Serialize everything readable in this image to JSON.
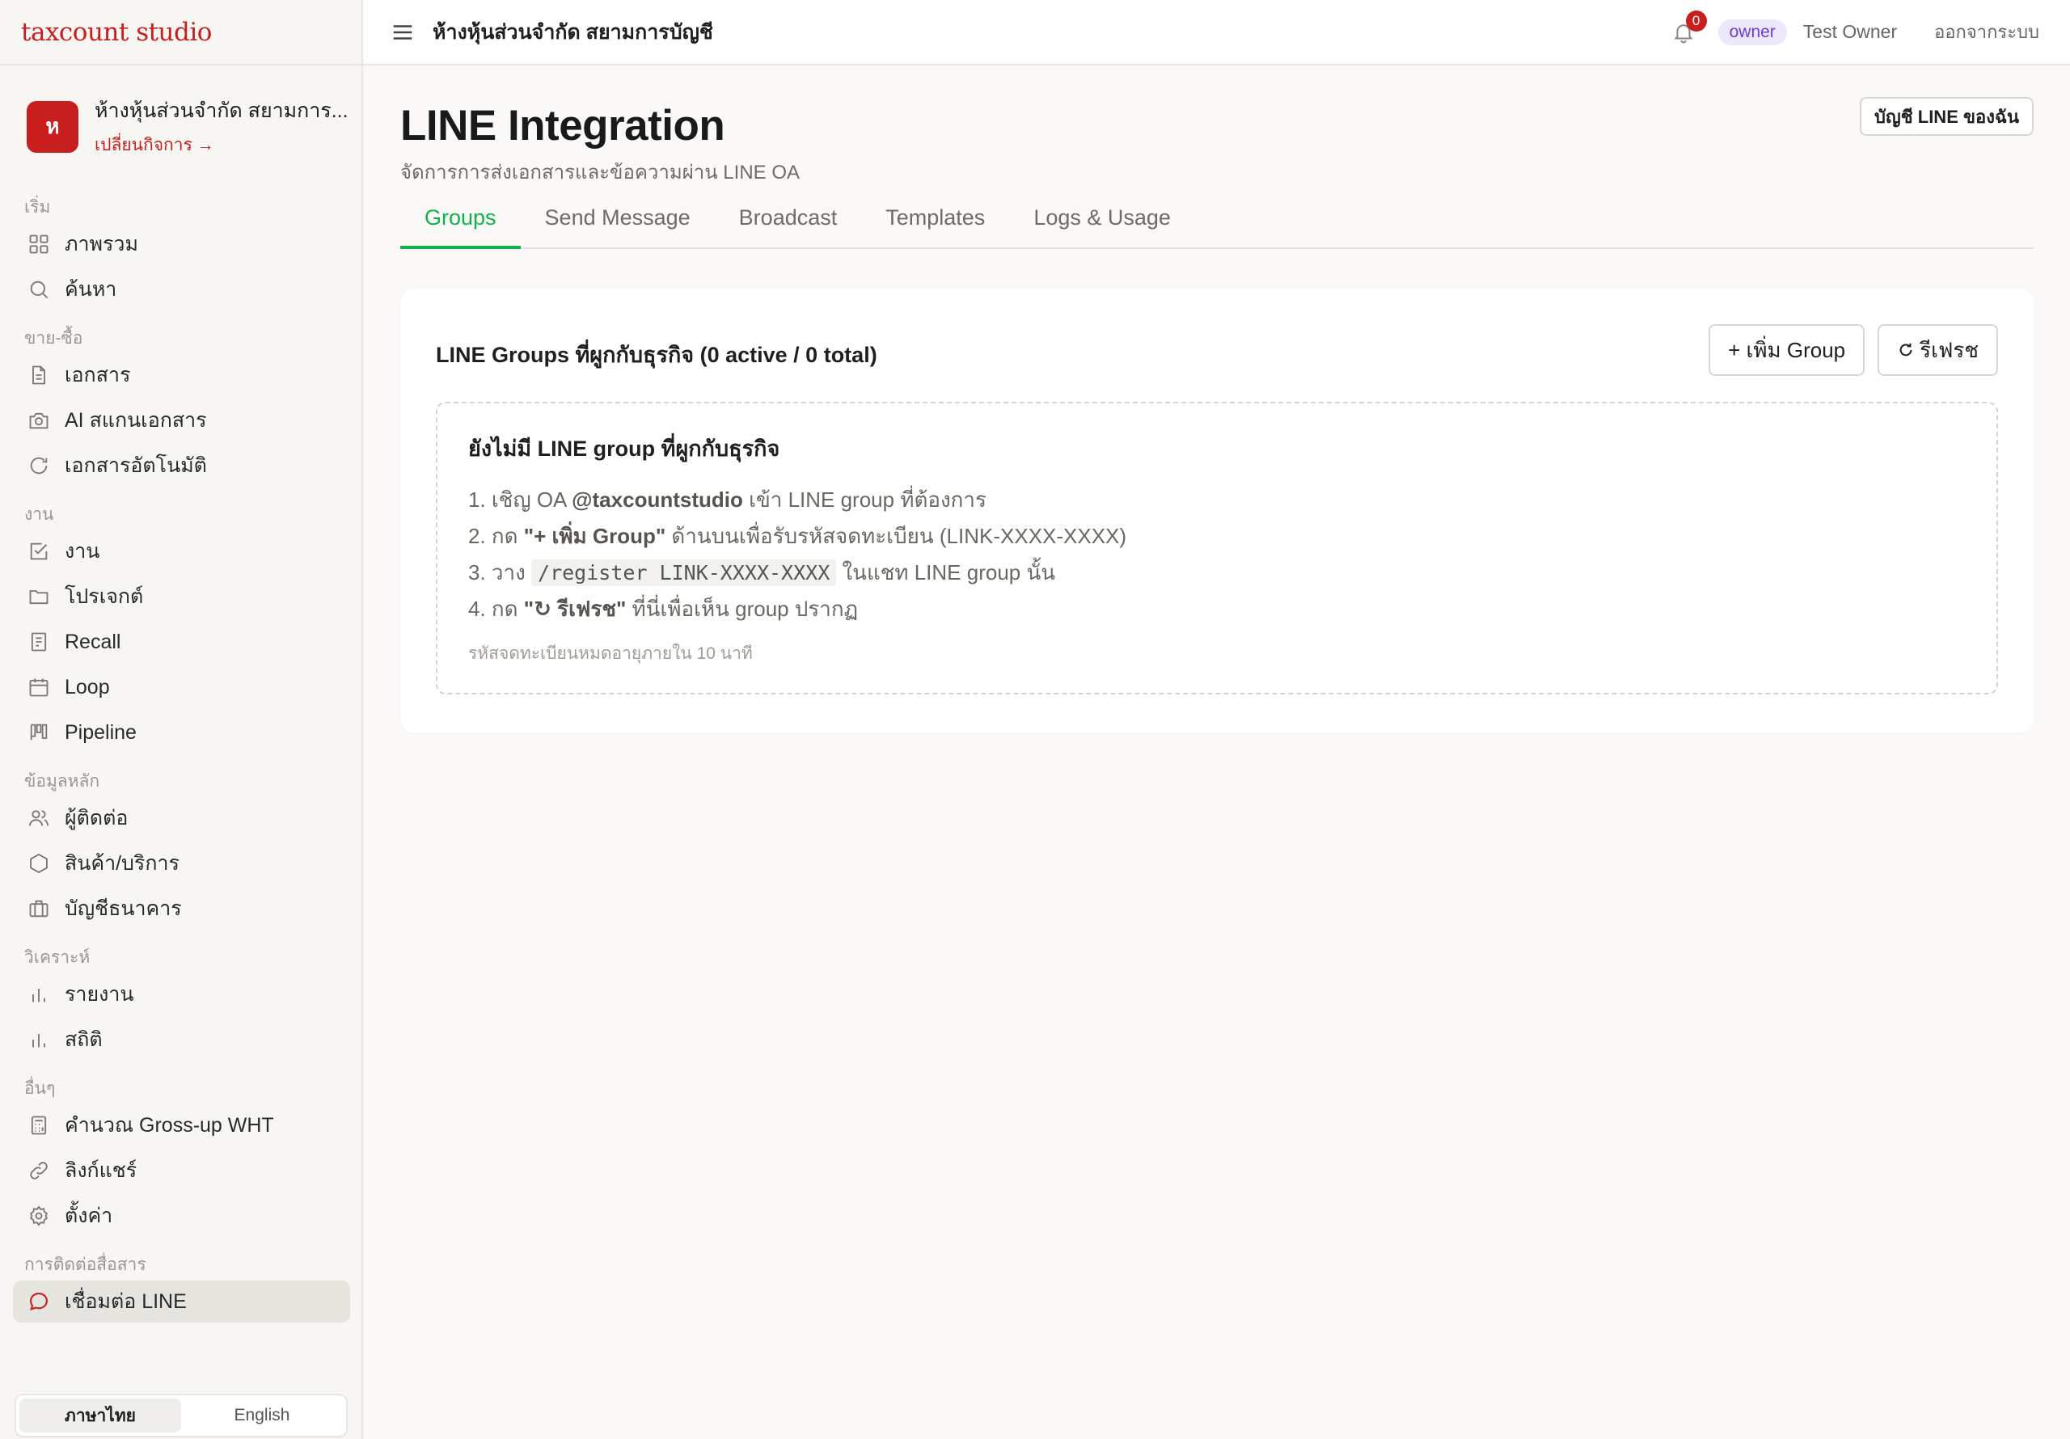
{
  "brand": "taxcount studio",
  "business": {
    "initial": "ห",
    "name": "ห้างหุ้นส่วนจำกัด สยามการ...",
    "switch_label": "เปลี่ยนกิจการ →"
  },
  "sidebar": {
    "sections": [
      {
        "label": "เริ่ม",
        "items": [
          {
            "label": "ภาพรวม",
            "icon": "grid-icon"
          },
          {
            "label": "ค้นหา",
            "icon": "search-icon"
          }
        ]
      },
      {
        "label": "ขาย-ซื้อ",
        "items": [
          {
            "label": "เอกสาร",
            "icon": "document-icon"
          },
          {
            "label": "AI สแกนเอกสาร",
            "icon": "camera-icon"
          },
          {
            "label": "เอกสารอัตโนมัติ",
            "icon": "refresh-icon"
          }
        ]
      },
      {
        "label": "งาน",
        "items": [
          {
            "label": "งาน",
            "icon": "check-square-icon"
          },
          {
            "label": "โปรเจกต์",
            "icon": "folder-icon"
          },
          {
            "label": "Recall",
            "icon": "receipt-icon"
          },
          {
            "label": "Loop",
            "icon": "calendar-icon"
          },
          {
            "label": "Pipeline",
            "icon": "kanban-icon"
          }
        ]
      },
      {
        "label": "ข้อมูลหลัก",
        "items": [
          {
            "label": "ผู้ติดต่อ",
            "icon": "users-icon"
          },
          {
            "label": "สินค้า/บริการ",
            "icon": "hexagon-icon"
          },
          {
            "label": "บัญชีธนาคาร",
            "icon": "briefcase-icon"
          }
        ]
      },
      {
        "label": "วิเคราะห์",
        "items": [
          {
            "label": "รายงาน",
            "icon": "bar-chart-icon"
          },
          {
            "label": "สถิติ",
            "icon": "bar-chart-icon"
          }
        ]
      },
      {
        "label": "อื่นๆ",
        "items": [
          {
            "label": "คำนวณ Gross-up WHT",
            "icon": "calculator-icon"
          },
          {
            "label": "ลิงก์แชร์",
            "icon": "link-icon"
          },
          {
            "label": "ตั้งค่า",
            "icon": "gear-icon"
          }
        ]
      },
      {
        "label": "การติดต่อสื่อสาร",
        "items": [
          {
            "label": "เชื่อมต่อ LINE",
            "icon": "chat-icon",
            "active": true
          }
        ]
      }
    ]
  },
  "language": {
    "thai": "ภาษาไทย",
    "english": "English",
    "selected": "thai"
  },
  "topbar": {
    "title": "ห้างหุ้นส่วนจำกัด สยามการบัญชี",
    "notification_count": "0",
    "role": "owner",
    "user": "Test Owner",
    "logout": "ออกจากระบบ"
  },
  "page": {
    "title": "LINE Integration",
    "subtitle": "จัดการการส่งเอกสารและข้อความผ่าน LINE OA",
    "my_line_button": "บัญชี LINE ของฉัน",
    "tabs": [
      "Groups",
      "Send Message",
      "Broadcast",
      "Templates",
      "Logs & Usage"
    ],
    "active_tab": "Groups"
  },
  "groups_card": {
    "title": "LINE Groups ที่ผูกกับธุรกิจ (0 active / 0 total)",
    "add_button": "+ เพิ่ม Group",
    "refresh_button": "รีเฟรช",
    "empty": {
      "title": "ยังไม่มี LINE group ที่ผูกกับธุรกิจ",
      "step1": {
        "pre": "1. เชิญ OA ",
        "strong": "@taxcountstudio",
        "post": " เข้า LINE group ที่ต้องการ"
      },
      "step2": {
        "pre": "2. กด ",
        "strong": "\"+ เพิ่ม Group\"",
        "post": " ด้านบนเพื่อรับรหัสจดทะเบียน (LINK-XXXX-XXXX)"
      },
      "step3": {
        "pre": "3. วาง ",
        "code": "/register LINK-XXXX-XXXX",
        "post": " ในแชท LINE group นั้น"
      },
      "step4": {
        "pre": "4. กด ",
        "strong": "\"↻ รีเฟรช\"",
        "post": " ที่นี่เพื่อเห็น group ปรากฏ"
      },
      "note": "รหัสจดทะเบียนหมดอายุภายใน 10 นาที"
    }
  },
  "colors": {
    "brand": "#c81e1e",
    "accent_green": "#10b34a",
    "role_purple": "#6a3fd1"
  }
}
